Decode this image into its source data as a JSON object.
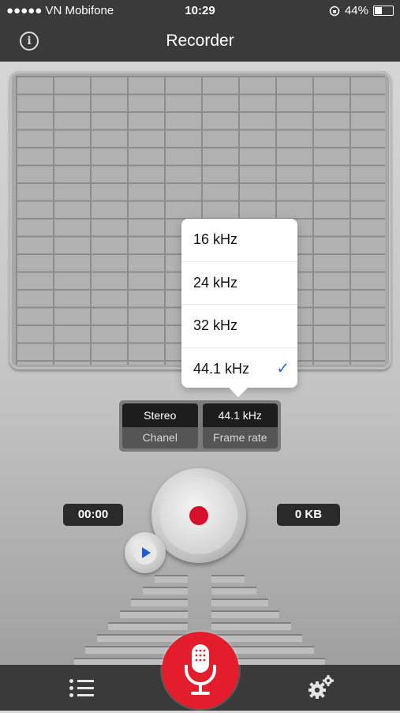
{
  "status_bar": {
    "carrier": "●●●●● VN Mobifone",
    "time": "10:29",
    "battery": "44%"
  },
  "header": {
    "title": "Recorder",
    "info_glyph": "i"
  },
  "frame_rate_popup": {
    "options": [
      {
        "label": "16 kHz",
        "selected": false
      },
      {
        "label": "24 kHz",
        "selected": false
      },
      {
        "label": "32 kHz",
        "selected": false
      },
      {
        "label": "44.1 kHz",
        "selected": true
      }
    ],
    "check_glyph": "✓"
  },
  "settings": {
    "channel": {
      "value": "Stereo",
      "label": "Chanel"
    },
    "frame_rate": {
      "value": "44.1 kHz",
      "label": "Frame rate"
    }
  },
  "recorder": {
    "elapsed": "00:00",
    "file_size": "0 KB"
  },
  "colors": {
    "record_red": "#d6102a",
    "mic_red": "#e41d2c",
    "play_blue": "#1f5fd1",
    "bar_dark": "#3a3a3a"
  },
  "icons": {
    "info": "info-icon",
    "record": "record-dot-icon",
    "play": "play-icon",
    "list": "list-icon",
    "mic": "microphone-icon",
    "settings": "gears-icon"
  }
}
